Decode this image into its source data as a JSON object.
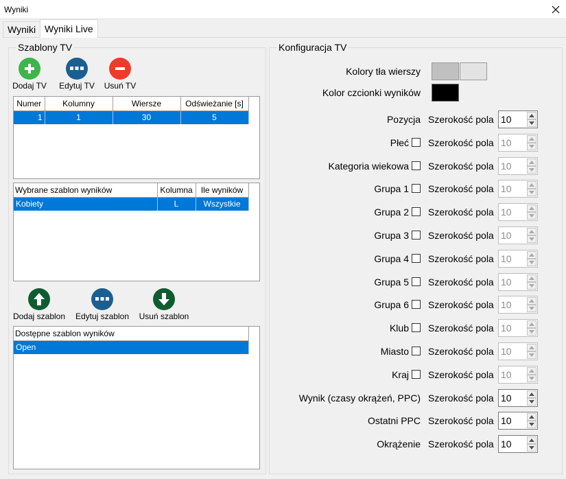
{
  "window": {
    "title": "Wyniki"
  },
  "tabs": [
    {
      "label": "Wyniki"
    },
    {
      "label": "Wyniki Live"
    }
  ],
  "templates": {
    "title": "Szablony TV",
    "add_label": "Dodaj TV",
    "edit_label": "Edytuj TV",
    "remove_label": "Usuń TV",
    "tv_table": {
      "columns": [
        "Numer",
        "Kolumny",
        "Wiersze",
        "Odświeżanie [s]"
      ],
      "rows": [
        [
          "1",
          "1",
          "30",
          "5"
        ]
      ]
    },
    "selected_table": {
      "columns": [
        "Wybrane szablon wyników",
        "Kolumna",
        "Ile wyników"
      ],
      "rows": [
        [
          "Kobiety",
          "L",
          "Wszystkie"
        ]
      ]
    },
    "add_template_label": "Dodaj szablon",
    "edit_template_label": "Edytuj szablon",
    "remove_template_label": "Usuń szablon",
    "available_table": {
      "columns": [
        "Dostępne szablon wyników"
      ],
      "rows": [
        [
          "Open"
        ]
      ]
    }
  },
  "config": {
    "title": "Konfiguracja TV",
    "row_bg_label": "Kolory tła wierszy",
    "font_color_label": "Kolor czcionki wyników",
    "colors": {
      "row_bg_1": "#c0c0c0",
      "row_bg_2": "#e3e3e3",
      "font_color": "#000000",
      "selection": "#0078d7",
      "add_green": "#3cb54a",
      "edit_blue": "#1a5f91",
      "remove_red": "#ef3b2c",
      "dark_green": "#0d5c2f"
    },
    "width_label": "Szerokość pola",
    "fields": [
      {
        "label": "Pozycja",
        "checkbox": false,
        "value": "10",
        "enabled": true
      },
      {
        "label": "Płeć",
        "checkbox": true,
        "value": "10",
        "enabled": false
      },
      {
        "label": "Kategoria wiekowa",
        "checkbox": true,
        "value": "10",
        "enabled": false
      },
      {
        "label": "Grupa 1",
        "checkbox": true,
        "value": "10",
        "enabled": false
      },
      {
        "label": "Grupa 2",
        "checkbox": true,
        "value": "10",
        "enabled": false
      },
      {
        "label": "Grupa 3",
        "checkbox": true,
        "value": "10",
        "enabled": false
      },
      {
        "label": "Grupa 4",
        "checkbox": true,
        "value": "10",
        "enabled": false
      },
      {
        "label": "Grupa 5",
        "checkbox": true,
        "value": "10",
        "enabled": false
      },
      {
        "label": "Grupa 6",
        "checkbox": true,
        "value": "10",
        "enabled": false
      },
      {
        "label": "Klub",
        "checkbox": true,
        "value": "10",
        "enabled": false
      },
      {
        "label": "Miasto",
        "checkbox": true,
        "value": "10",
        "enabled": false
      },
      {
        "label": "Kraj",
        "checkbox": true,
        "value": "10",
        "enabled": false
      },
      {
        "label": "Wynik (czasy okrążeń, PPC)",
        "checkbox": false,
        "value": "10",
        "enabled": true
      },
      {
        "label": "Ostatni PPC",
        "checkbox": false,
        "value": "10",
        "enabled": true
      },
      {
        "label": "Okrążenie",
        "checkbox": false,
        "value": "10",
        "enabled": true
      }
    ]
  }
}
